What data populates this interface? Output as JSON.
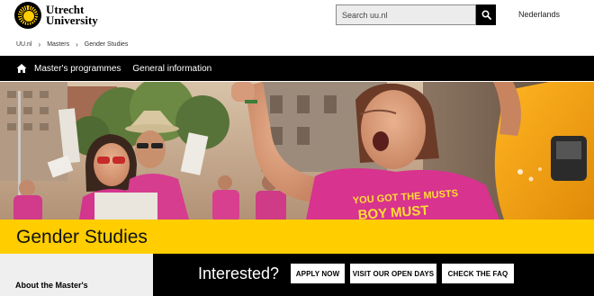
{
  "header": {
    "logo_line1": "Utrecht",
    "logo_line2": "University",
    "search_placeholder": "Search uu.nl",
    "language_link": "Nederlands"
  },
  "breadcrumb": [
    "UU.nl",
    "Masters",
    "Gender Studies"
  ],
  "nav": {
    "items": [
      "Master's programmes",
      "General information"
    ]
  },
  "hero": {
    "shirt_text_1": "YOU GOT THE MUSTS",
    "shirt_text_2": "BOY MUST"
  },
  "page_title": "Gender Studies",
  "sidebar": {
    "item": "About the Master's"
  },
  "cta": {
    "heading": "Interested?",
    "buttons": [
      "APPLY NOW",
      "VISIT OUR OPEN DAYS",
      "CHECK THE FAQ"
    ]
  },
  "colors": {
    "brand_yellow": "#ffcd00",
    "black": "#000000",
    "shirt_pink": "#d7338f"
  }
}
